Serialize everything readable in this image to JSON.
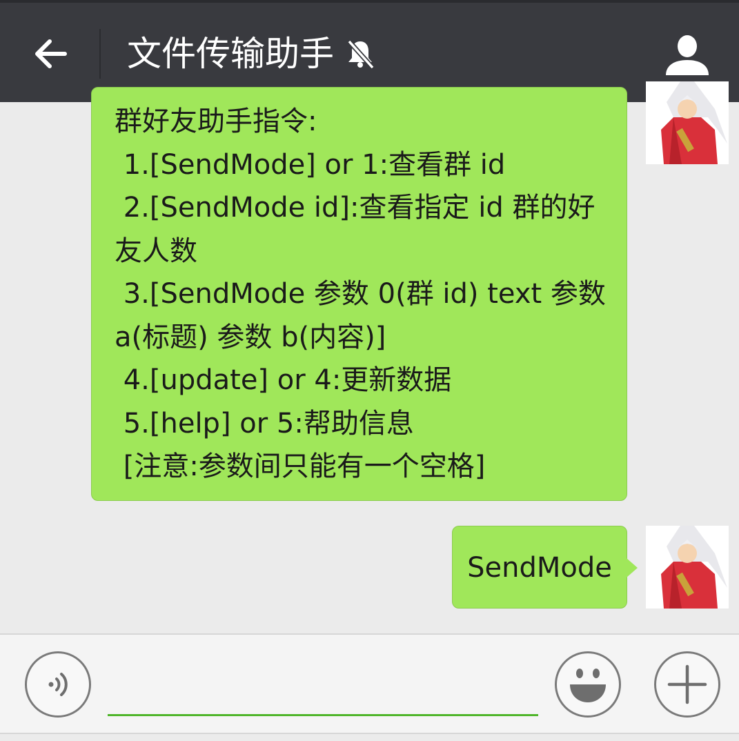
{
  "header": {
    "back_icon": "arrow-left-icon",
    "title": "文件传输助手",
    "mute_icon": "bell-off-icon",
    "profile_icon": "person-icon"
  },
  "messages": [
    {
      "sender": "self",
      "avatar_icon": "inuyasha-avatar",
      "lines": [
        "群好友助手指令:",
        " 1.[SendMode] or 1:查看群 id",
        " 2.[SendMode id]:查看指定 id 群的好",
        "友人数",
        " 3.[SendMode 参数 0(群 id) text 参数",
        "a(标题) 参数 b(内容)]",
        " 4.[update] or 4:更新数据",
        " 5.[help] or 5:帮助信息",
        " [注意:参数间只能有一个空格]"
      ]
    },
    {
      "sender": "self",
      "avatar_icon": "inuyasha-avatar",
      "text": "SendMode"
    }
  ],
  "input_bar": {
    "voice_icon": "voice-icon",
    "input_value": "",
    "emoji_icon": "emoji-icon",
    "plus_icon": "plus-icon"
  },
  "colors": {
    "header_bg": "#393a3f",
    "chat_bg": "#ebebeb",
    "bubble_green": "#a0e75a",
    "input_underline": "#4fb52a"
  }
}
